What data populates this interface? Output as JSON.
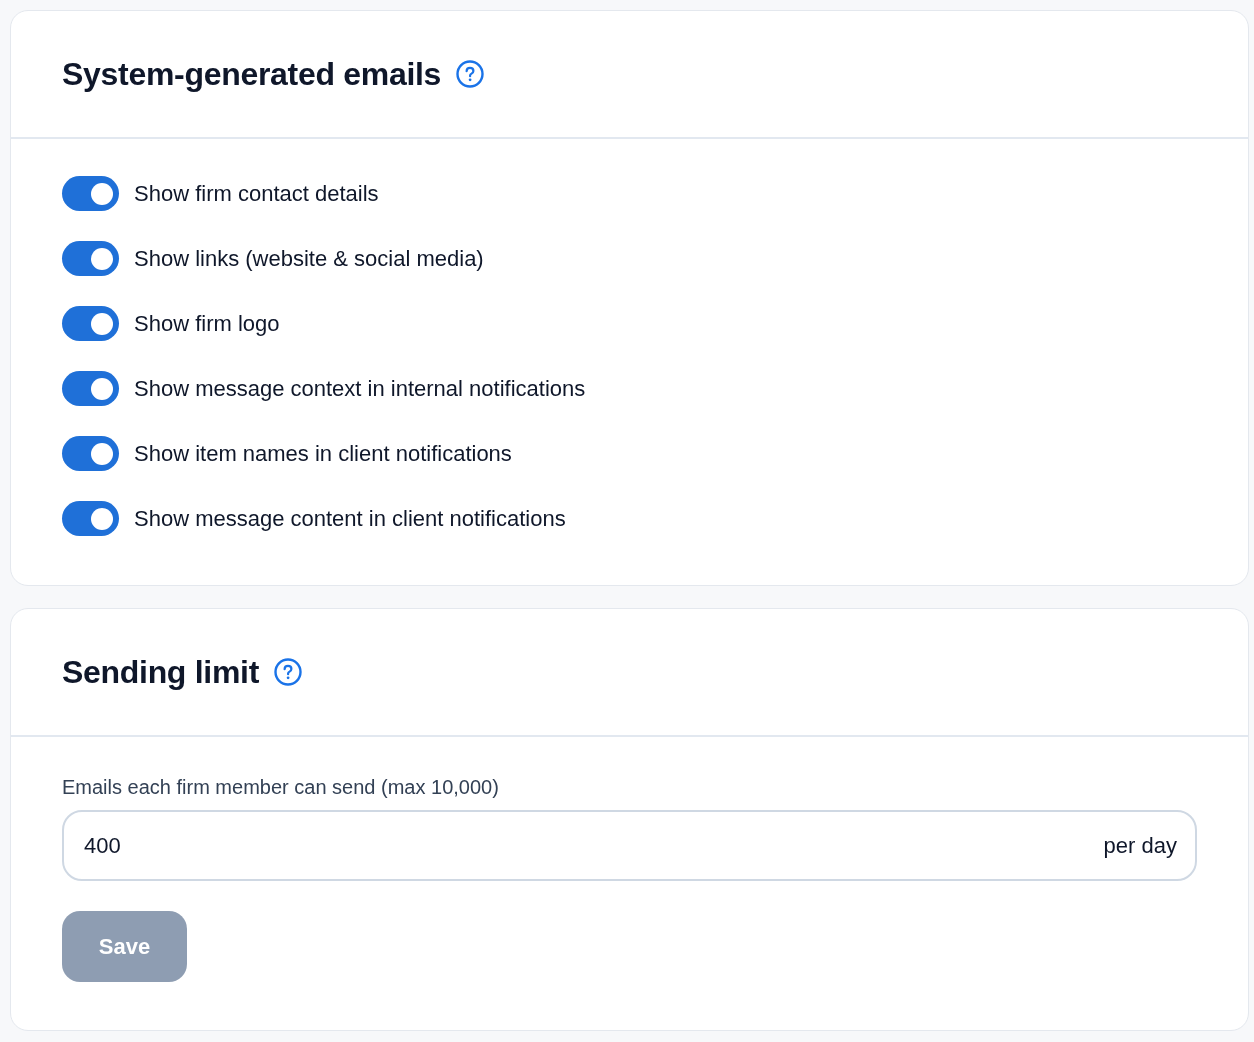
{
  "sections": [
    {
      "kind": "toggles",
      "title": "System-generated emails",
      "toggles": [
        {
          "label": "Show firm contact details",
          "on": true
        },
        {
          "label": "Show links (website & social media)",
          "on": true
        },
        {
          "label": "Show firm logo",
          "on": true
        },
        {
          "label": "Show message context in internal notifications",
          "on": true
        },
        {
          "label": "Show item names in client notifications",
          "on": true
        },
        {
          "label": "Show message content in client notifications",
          "on": true
        }
      ]
    },
    {
      "kind": "limit",
      "title": "Sending limit",
      "field": {
        "label": "Emails each firm member can send (max 10,000)",
        "value": "400",
        "suffix": "per day"
      },
      "save_button": {
        "label": "Save",
        "disabled": true
      }
    }
  ]
}
